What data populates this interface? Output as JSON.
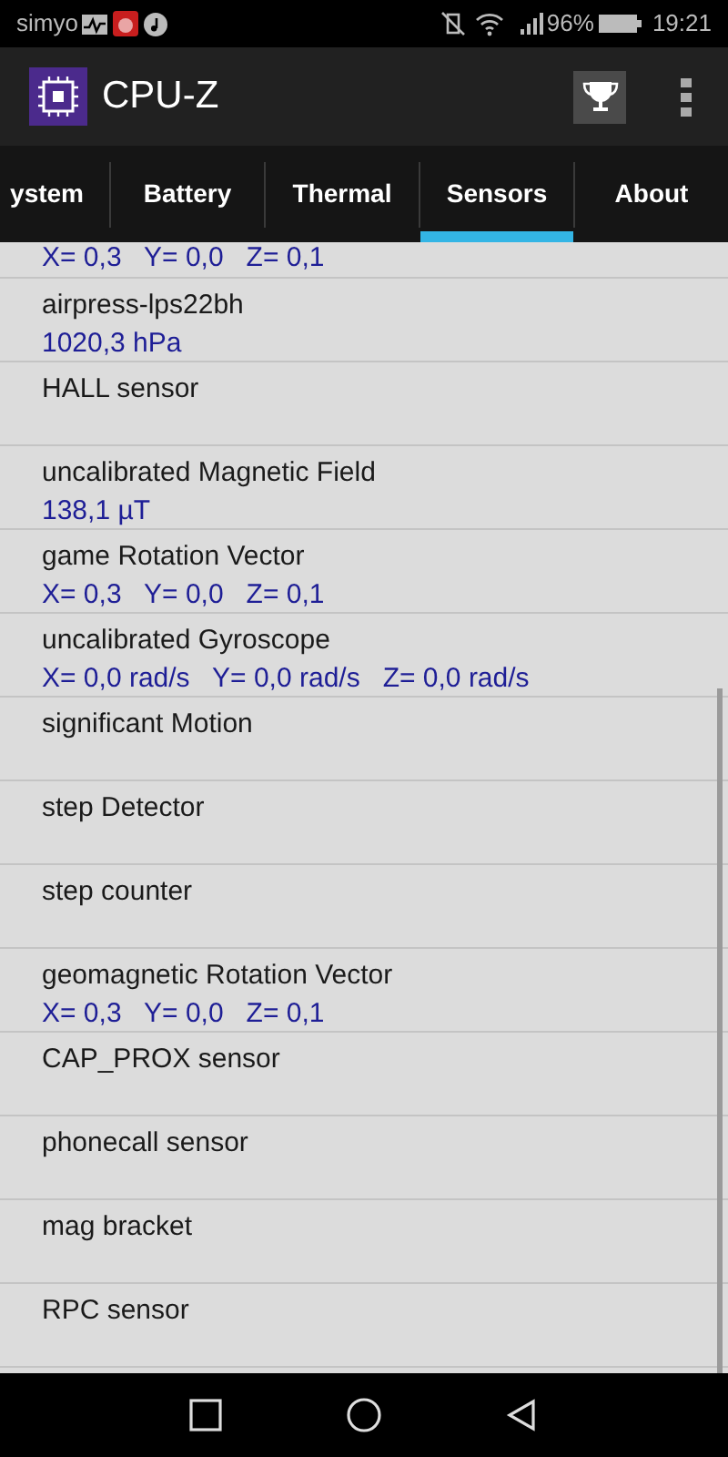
{
  "status_bar": {
    "carrier": "simyo",
    "battery_percent": "96%",
    "time": "19:21"
  },
  "app_bar": {
    "title": "CPU-Z"
  },
  "tabs": [
    {
      "label": "ystem",
      "selected": false
    },
    {
      "label": "Battery",
      "selected": false
    },
    {
      "label": "Thermal",
      "selected": false
    },
    {
      "label": "Sensors",
      "selected": true
    },
    {
      "label": "About",
      "selected": false
    }
  ],
  "sensors": [
    {
      "value": "X= 0,3   Y= 0,0   Z= 0,1"
    },
    {
      "name": "airpress-lps22bh",
      "value": "1020,3 hPa"
    },
    {
      "name": "HALL sensor"
    },
    {
      "name": "uncalibrated Magnetic Field",
      "value": "138,1 µT"
    },
    {
      "name": "game Rotation Vector",
      "value": "X= 0,3   Y= 0,0   Z= 0,1"
    },
    {
      "name": "uncalibrated Gyroscope",
      "value": "X= 0,0 rad/s   Y= 0,0 rad/s   Z= 0,0 rad/s"
    },
    {
      "name": "significant Motion"
    },
    {
      "name": "step Detector"
    },
    {
      "name": "step counter"
    },
    {
      "name": "geomagnetic Rotation Vector",
      "value": "X= 0,3   Y= 0,0   Z= 0,1"
    },
    {
      "name": "CAP_PROX sensor"
    },
    {
      "name": "phonecall sensor"
    },
    {
      "name": "mag bracket"
    },
    {
      "name": "RPC sensor"
    }
  ]
}
